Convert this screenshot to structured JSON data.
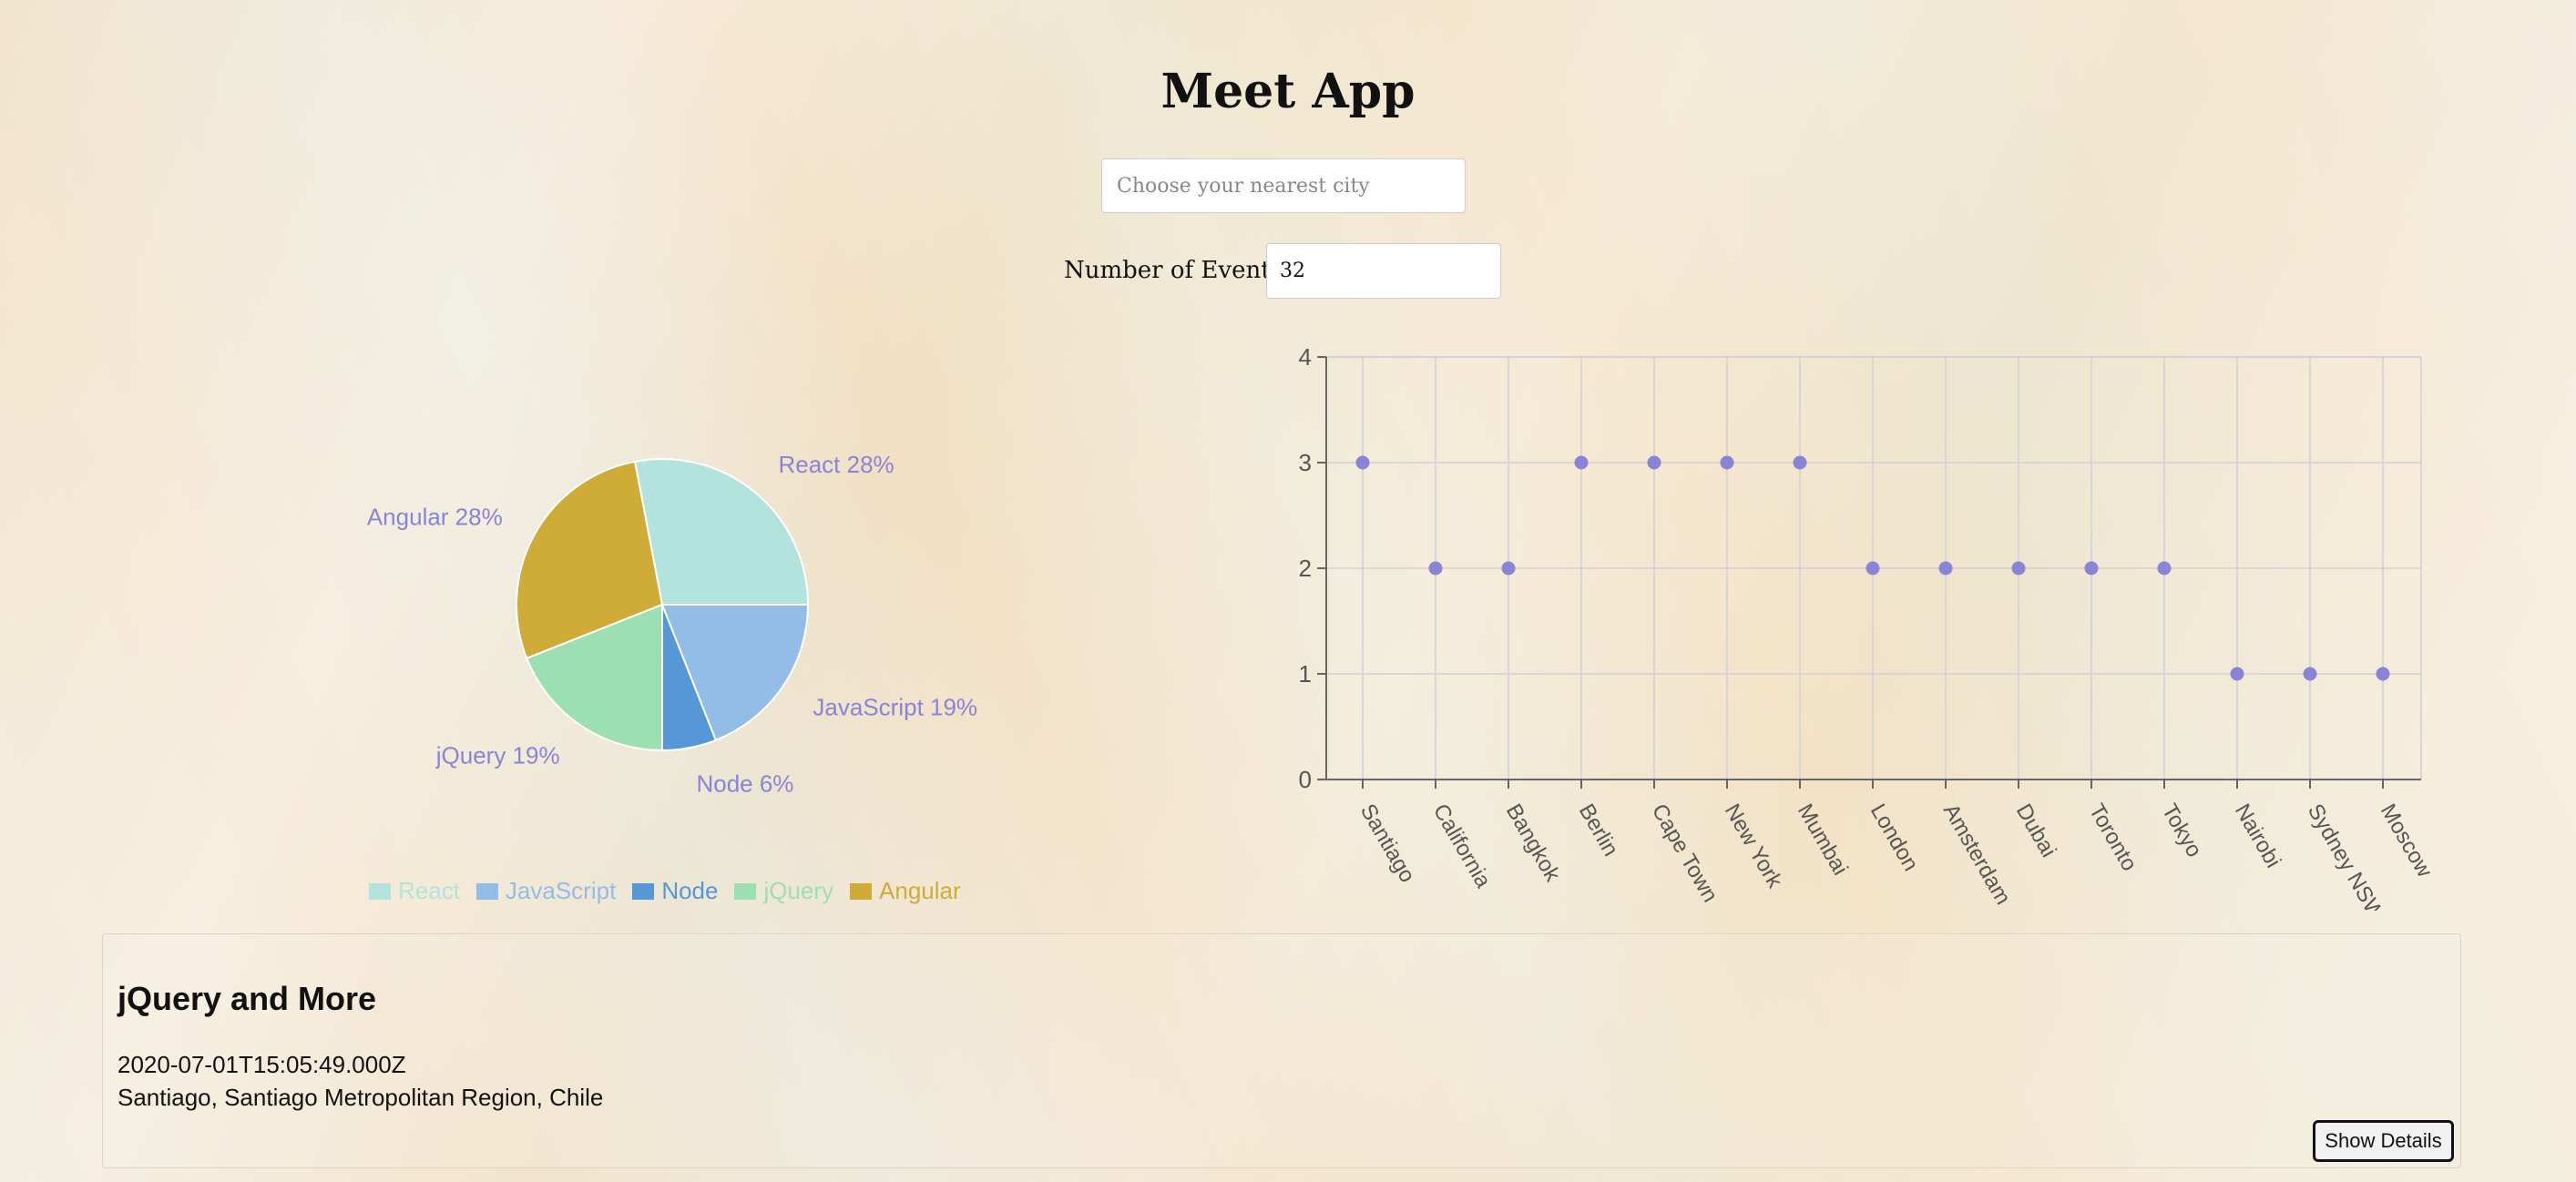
{
  "app": {
    "title": "Meet App"
  },
  "search": {
    "placeholder": "Choose your nearest city",
    "value": ""
  },
  "events_count": {
    "label": "Number of Events:",
    "value": "32"
  },
  "colors": {
    "pie_label": "#8884d8",
    "scatter_point": "#8884d8",
    "React": "#b2e3dc",
    "JavaScript": "#92bde6",
    "Node": "#5697d8",
    "jQuery": "#9cdfb0",
    "Angular": "#cfac38"
  },
  "chart_data": [
    {
      "type": "pie",
      "slices": [
        {
          "name": "React",
          "value": 28,
          "label": "React 28%"
        },
        {
          "name": "Angular",
          "value": 28,
          "label": "Angular 28%"
        },
        {
          "name": "jQuery",
          "value": 19,
          "label": "jQuery 19%"
        },
        {
          "name": "Node",
          "value": 6,
          "label": "Node 6%"
        },
        {
          "name": "JavaScript",
          "value": 19,
          "label": "JavaScript 19%"
        }
      ],
      "legend": [
        "React",
        "JavaScript",
        "Node",
        "jQuery",
        "Angular"
      ],
      "legend_position": "bottom"
    },
    {
      "type": "scatter",
      "categories": [
        "Santiago",
        "California",
        "Bangkok",
        "Berlin",
        "Cape Town",
        "New York",
        "Mumbai",
        "London",
        "Amsterdam",
        "Dubai",
        "Toronto",
        "Tokyo",
        "Nairobi",
        "Sydney NSW",
        "Moscow"
      ],
      "values": [
        3,
        2,
        2,
        3,
        3,
        3,
        3,
        2,
        2,
        2,
        2,
        2,
        1,
        1,
        1
      ],
      "yticks": [
        "0",
        "1",
        "2",
        "3",
        "4"
      ],
      "ylim": [
        0,
        4
      ],
      "grid": true
    }
  ],
  "event": {
    "title": "jQuery and More",
    "date": "2020-07-01T15:05:49.000Z",
    "location": "Santiago, Santiago Metropolitan Region, Chile",
    "details_button": "Show Details"
  }
}
